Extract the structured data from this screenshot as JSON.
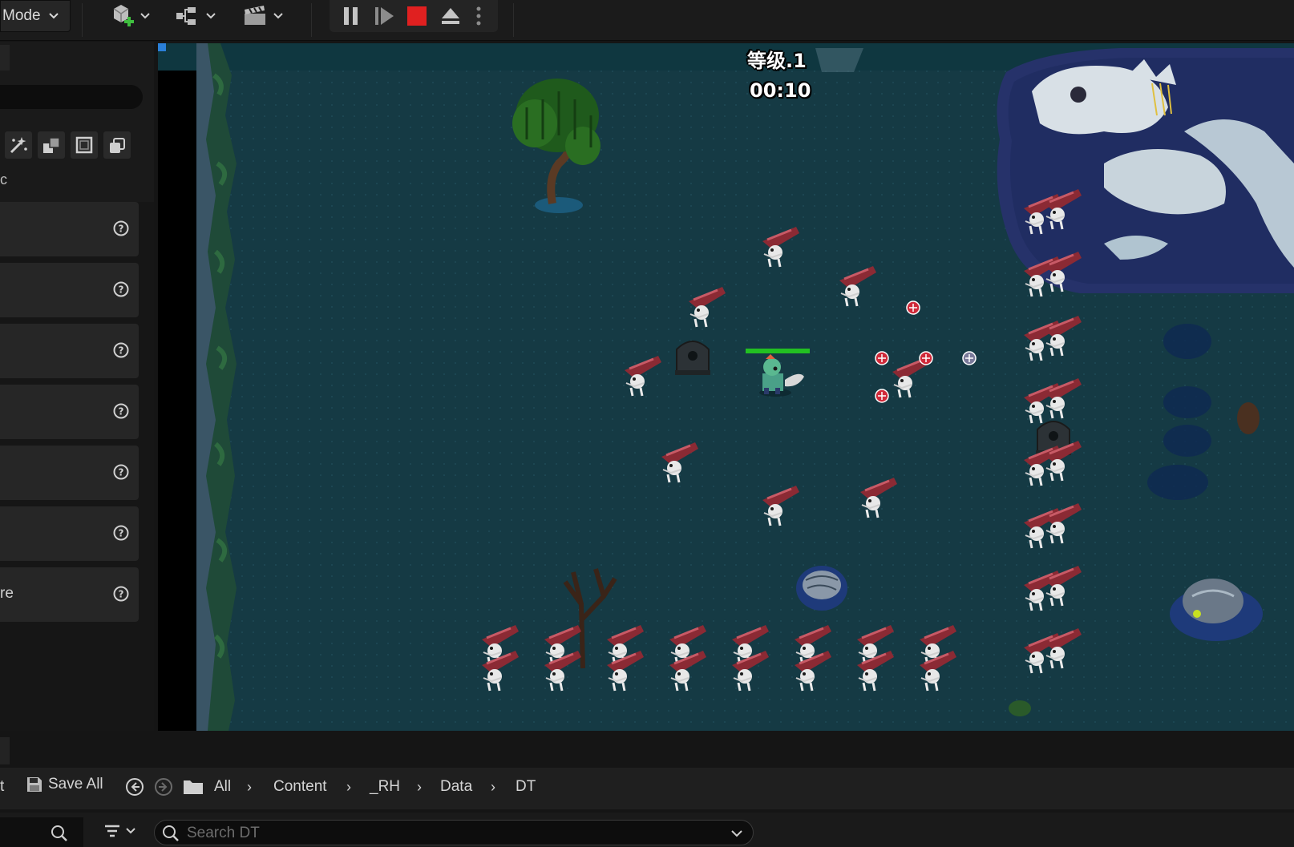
{
  "toolbar": {
    "mode_label": "Mode",
    "icons": [
      "add-actor-icon",
      "blueprint-icon",
      "cinematics-icon",
      "pause-icon",
      "step-icon",
      "stop-icon",
      "eject-icon",
      "more-options-icon"
    ],
    "stop_color": "#e02020"
  },
  "left_panel": {
    "tool_icons": [
      "magic-wand-icon",
      "blocks-icon",
      "square-icon",
      "layers-icon"
    ],
    "partial_letter": "c",
    "items": [
      {
        "label": ""
      },
      {
        "label": ""
      },
      {
        "label": ""
      },
      {
        "label": ""
      },
      {
        "label": ""
      },
      {
        "label": ""
      },
      {
        "label": "re"
      }
    ]
  },
  "game": {
    "level_text": "等级.1",
    "timer_text": "00:10",
    "ground_color": "#153a44",
    "health_bar_color": "#22c022"
  },
  "content_browser": {
    "partial_left_text": "t",
    "save_all_label": "Save All",
    "breadcrumbs": [
      "All",
      "Content",
      "_RH",
      "Data",
      "DT"
    ],
    "search_placeholder": "Search DT"
  }
}
